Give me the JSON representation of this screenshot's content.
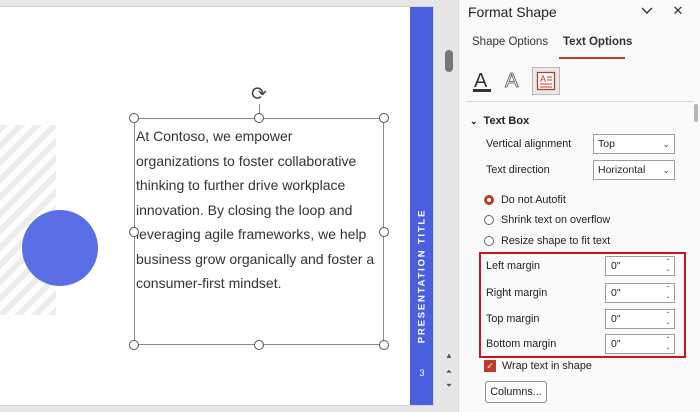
{
  "slide": {
    "body_lines": [
      "At Contoso, we empower",
      "organizations to foster collaborative",
      "thinking to further drive workplace",
      "innovation. By closing the loop and",
      "leveraging agile frameworks, we help",
      "business grow organically and foster a",
      "consumer-first mindset."
    ],
    "vertical_title": "PRESENTATION TITLE",
    "slide_number": "3",
    "accent_color": "#4a5fe0"
  },
  "pane": {
    "title": "Format Shape",
    "tabs": [
      {
        "label": "Shape Options",
        "selected": false
      },
      {
        "label": "Text Options",
        "selected": true
      }
    ],
    "categories": [
      {
        "name": "text-fill-outline",
        "selected": false
      },
      {
        "name": "text-effects",
        "selected": false
      },
      {
        "name": "textbox",
        "selected": true
      }
    ],
    "section": {
      "title": "Text Box",
      "vertical_alignment": {
        "label": "Vertical alignment",
        "value": "Top"
      },
      "text_direction": {
        "label": "Text direction",
        "value": "Horizontal"
      },
      "autofit_options": [
        {
          "label": "Do not Autofit",
          "checked": true
        },
        {
          "label": "Shrink text on overflow",
          "checked": false
        },
        {
          "label": "Resize shape to fit text",
          "checked": false
        }
      ],
      "margins": [
        {
          "label": "Left margin",
          "value": "0\""
        },
        {
          "label": "Right margin",
          "value": "0\""
        },
        {
          "label": "Top margin",
          "value": "0\""
        },
        {
          "label": "Bottom margin",
          "value": "0\""
        }
      ],
      "wrap_text": {
        "label": "Wrap text in shape",
        "checked": true
      },
      "columns_button": "Columns..."
    }
  },
  "highlight_color": "#d0141e"
}
